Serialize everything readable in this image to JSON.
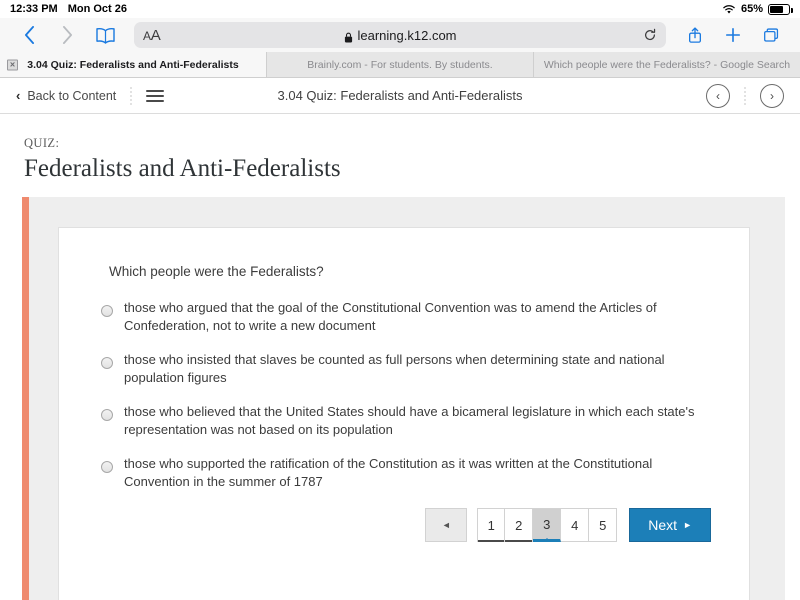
{
  "status_bar": {
    "time": "12:33 PM",
    "date": "Mon Oct 26",
    "battery_percent": "65%",
    "wifi_icon": "wifi-icon",
    "battery_icon": "battery-icon"
  },
  "browser": {
    "back_icon": "chevron-left-icon",
    "forward_icon": "chevron-right-icon",
    "bookmarks_icon": "book-icon",
    "aa_label_small": "A",
    "aa_label_large": "A",
    "url": "learning.k12.com",
    "lock_icon": "lock-icon",
    "reload_icon": "reload-icon",
    "share_icon": "share-icon",
    "new_tab_icon": "plus-icon",
    "tabs_overview_icon": "tabs-icon",
    "tabs": [
      {
        "title": "3.04 Quiz: Federalists and Anti-Federalists",
        "active": true,
        "close_label": "×"
      },
      {
        "title": "Brainly.com - For students. By students.",
        "active": false
      },
      {
        "title": "Which people were the Federalists? - Google Search",
        "active": false
      }
    ]
  },
  "app_nav": {
    "back_label": "Back to Content",
    "back_chevron": "‹",
    "menu_icon": "hamburger-menu-icon",
    "title": "3.04 Quiz: Federalists and Anti-Federalists",
    "prev_icon": "‹",
    "next_icon": "›"
  },
  "quiz": {
    "kicker": "QUIZ:",
    "title": "Federalists and Anti-Federalists",
    "question": "Which people were the Federalists?",
    "options": [
      "those who argued that the goal of the Constitutional Convention was to amend the Articles of Confederation, not to write a new document",
      "those who insisted that slaves be counted as full persons when determining state and national population figures",
      "those who believed that the United States should have a bicameral legislature in which each state's representation was not based on its population",
      "those who supported the ratification of the Constitution as it was written at the Constitutional Convention in the summer of 1787"
    ]
  },
  "pagination": {
    "prev_label": "◄",
    "pages": [
      "1",
      "2",
      "3",
      "4",
      "5"
    ],
    "current_page": "3",
    "next_label": "Next",
    "next_arrow": "►"
  },
  "colors": {
    "accent_stripe": "#ef8a6e",
    "primary_blue": "#1c7fb8",
    "safari_blue": "#1b7ae0"
  }
}
